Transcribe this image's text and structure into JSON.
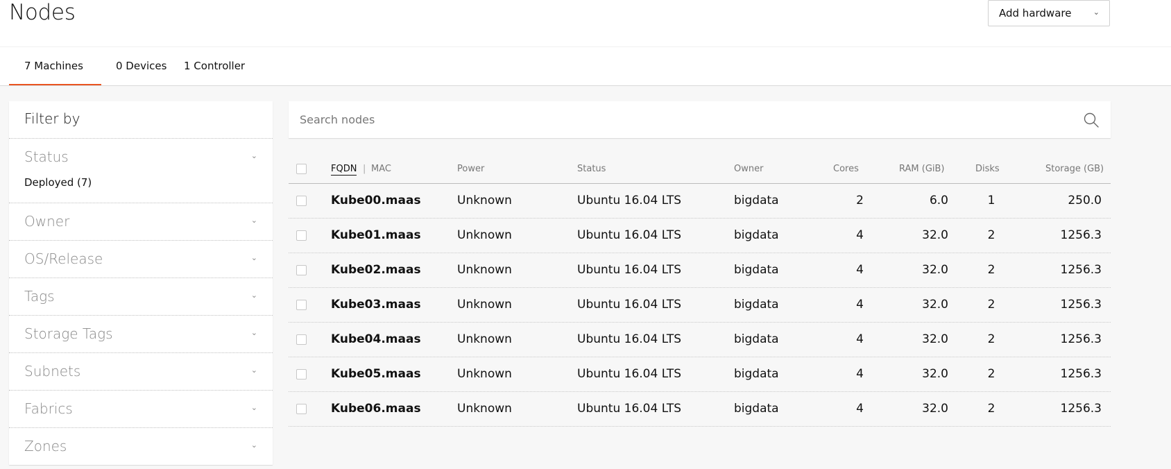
{
  "header": {
    "title": "Nodes",
    "add_hardware_label": "Add hardware"
  },
  "tabs": [
    {
      "label": "7 Machines",
      "active": true
    },
    {
      "label": "0 Devices",
      "active": false
    },
    {
      "label": "1 Controller",
      "active": false
    }
  ],
  "filter": {
    "title": "Filter by",
    "facets": [
      {
        "label": "Status",
        "selected": "Deployed (7)"
      },
      {
        "label": "Owner"
      },
      {
        "label": "OS/Release"
      },
      {
        "label": "Tags"
      },
      {
        "label": "Storage Tags"
      },
      {
        "label": "Subnets"
      },
      {
        "label": "Fabrics"
      },
      {
        "label": "Zones"
      }
    ]
  },
  "search": {
    "placeholder": "Search nodes",
    "value": ""
  },
  "table": {
    "columns": {
      "fqdn": "FQDN",
      "separator": "|",
      "mac": "MAC",
      "power": "Power",
      "status": "Status",
      "owner": "Owner",
      "cores": "Cores",
      "ram": "RAM (GiB)",
      "disks": "Disks",
      "storage": "Storage (GB)"
    },
    "rows": [
      {
        "fqdn": "Kube00.maas",
        "power": "Unknown",
        "status": "Ubuntu 16.04 LTS",
        "owner": "bigdata",
        "cores": "2",
        "ram": "6.0",
        "disks": "1",
        "storage": "250.0"
      },
      {
        "fqdn": "Kube01.maas",
        "power": "Unknown",
        "status": "Ubuntu 16.04 LTS",
        "owner": "bigdata",
        "cores": "4",
        "ram": "32.0",
        "disks": "2",
        "storage": "1256.3"
      },
      {
        "fqdn": "Kube02.maas",
        "power": "Unknown",
        "status": "Ubuntu 16.04 LTS",
        "owner": "bigdata",
        "cores": "4",
        "ram": "32.0",
        "disks": "2",
        "storage": "1256.3"
      },
      {
        "fqdn": "Kube03.maas",
        "power": "Unknown",
        "status": "Ubuntu 16.04 LTS",
        "owner": "bigdata",
        "cores": "4",
        "ram": "32.0",
        "disks": "2",
        "storage": "1256.3"
      },
      {
        "fqdn": "Kube04.maas",
        "power": "Unknown",
        "status": "Ubuntu 16.04 LTS",
        "owner": "bigdata",
        "cores": "4",
        "ram": "32.0",
        "disks": "2",
        "storage": "1256.3"
      },
      {
        "fqdn": "Kube05.maas",
        "power": "Unknown",
        "status": "Ubuntu 16.04 LTS",
        "owner": "bigdata",
        "cores": "4",
        "ram": "32.0",
        "disks": "2",
        "storage": "1256.3"
      },
      {
        "fqdn": "Kube06.maas",
        "power": "Unknown",
        "status": "Ubuntu 16.04 LTS",
        "owner": "bigdata",
        "cores": "4",
        "ram": "32.0",
        "disks": "2",
        "storage": "1256.3"
      }
    ]
  },
  "icons": {
    "search": "search-icon",
    "chevron": "chevron-down-icon"
  },
  "colors": {
    "accent": "#e95420",
    "background": "#f7f7f7",
    "panel": "#ffffff"
  }
}
